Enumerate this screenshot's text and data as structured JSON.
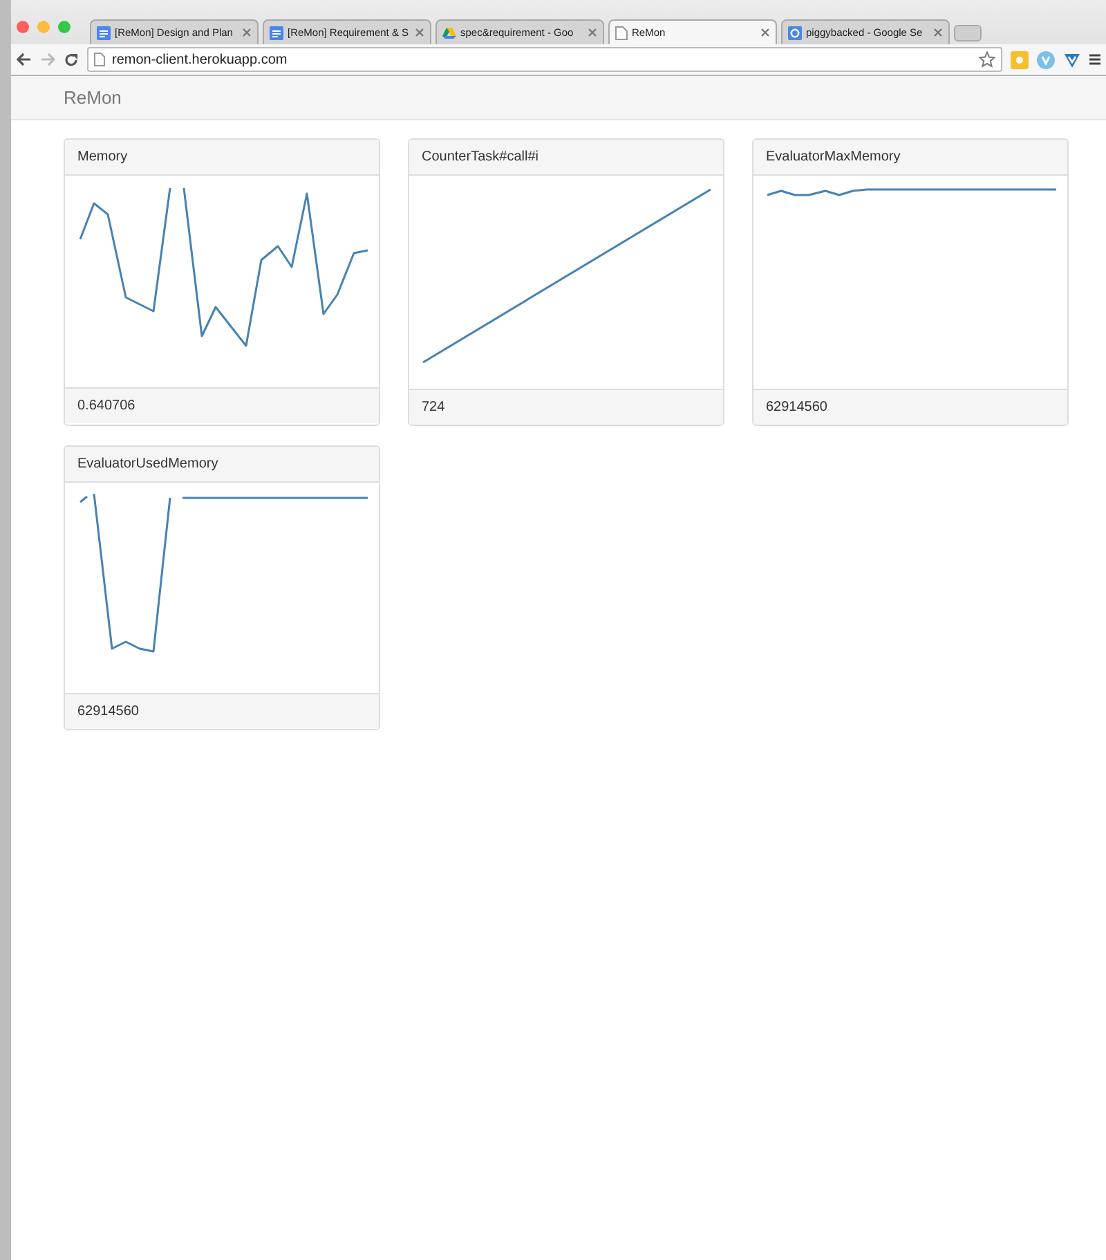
{
  "browser": {
    "tabs": [
      {
        "title": "[ReMon] Design and Plan",
        "selected": false
      },
      {
        "title": "[ReMon] Requirement & S",
        "selected": false
      },
      {
        "title": "spec&requirement - Goo",
        "selected": false
      },
      {
        "title": "ReMon",
        "selected": true
      },
      {
        "title": "piggybacked - Google Se",
        "selected": false
      }
    ],
    "address": "remon-client.herokuapp.com"
  },
  "navbar": {
    "brand": "ReMon"
  },
  "cards": [
    {
      "title": "Memory",
      "value": "0.640706"
    },
    {
      "title": "CounterTask#call#i",
      "value": "724"
    },
    {
      "title": "EvaluatorMaxMemory",
      "value": "62914560"
    },
    {
      "title": "EvaluatorUsedMemory",
      "value": "62914560"
    }
  ]
}
